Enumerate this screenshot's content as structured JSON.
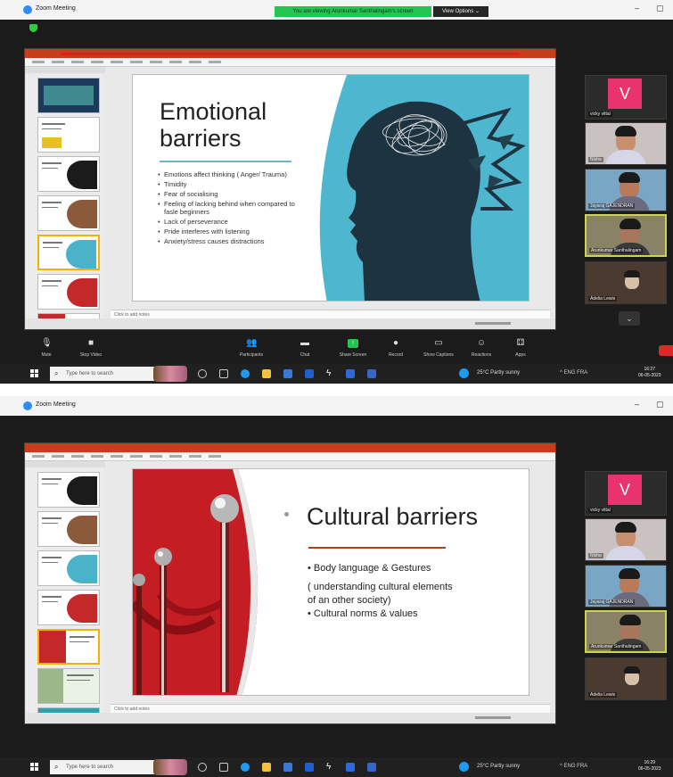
{
  "app": {
    "title": "Zoom Meeting",
    "accent": "#2d8cff"
  },
  "share_banner": "You are viewing Arunkumar Santhalingam's screen",
  "view_options": "View Options ⌄",
  "window_controls": {
    "minimize": "–",
    "maximize": "▢"
  },
  "slides": {
    "emotional": {
      "title_line1": "Emotional",
      "title_line2": "barriers",
      "bullets": [
        "Emotions affect thinking ( Anger/ Trauma)",
        "Timidity",
        "Fear of socialising",
        "Feeling of lacking behind when compared to fasle beginners",
        "Lack of perseverance",
        "Pride interferes with listening",
        "Anxiety/stress causes distractions"
      ]
    },
    "cultural": {
      "title": "Cultural barriers",
      "bullets": [
        "• Body language & Gestures",
        "( understanding cultural elements",
        "of an other society)",
        "• Cultural norms & values"
      ]
    }
  },
  "notes_placeholder": "Click to add notes",
  "participants": [
    {
      "name": "vicky vittal",
      "initial": "V",
      "color": "#e8336f"
    },
    {
      "name": "Nisha"
    },
    {
      "name": "Jayaraj GAJENDRAN"
    },
    {
      "name": "Arunkumar Santhalingam"
    },
    {
      "name": "Adelia Lewis"
    }
  ],
  "more_arrow": "⌄",
  "controls": {
    "mute": "Mute",
    "stop_video": "Stop Video",
    "participants": "Participants",
    "participants_count": "21",
    "chat": "Chat",
    "share_screen": "Share Screen",
    "record": "Record",
    "show_captions": "Show Captions",
    "reactions": "Reactions",
    "apps": "Apps"
  },
  "taskbar": {
    "search_placeholder": "Type here to search",
    "weather": "25°C  Partly sunny",
    "tray": "^  ENG  FRA",
    "time1": "16:27",
    "time2": "16:29",
    "date": "06-05-2023"
  }
}
